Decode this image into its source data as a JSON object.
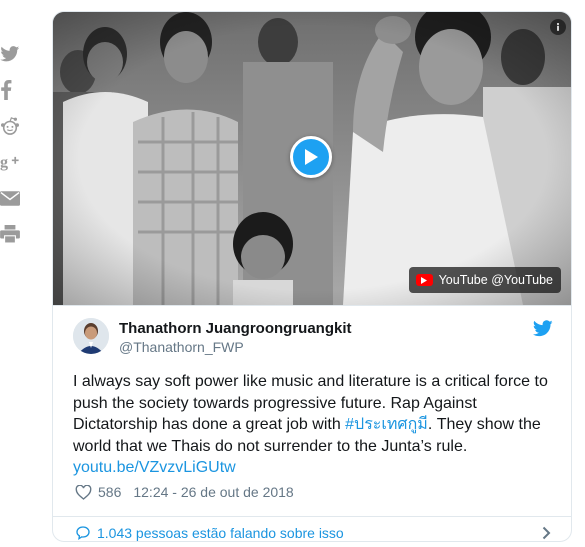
{
  "share": {
    "buttons": [
      {
        "name": "twitter-share-icon"
      },
      {
        "name": "facebook-share-icon"
      },
      {
        "name": "reddit-share-icon"
      },
      {
        "name": "google-plus-share-icon"
      },
      {
        "name": "email-share-icon"
      },
      {
        "name": "print-icon"
      }
    ]
  },
  "media": {
    "badge_label": "YouTube @YouTube"
  },
  "tweet": {
    "author_name": "Thanathorn Juangroongruangkit",
    "author_handle": "@Thanathorn_FWP",
    "text_part1": "I always say soft power like music and literature is a critical force to push the society towards progressive future. Rap Against Dictatorship has done a great job with ",
    "hashtag": "#ประเทศกูมี",
    "text_part2": ". They show the world that we Thais do not surrender to the Junta’s rule.",
    "link": "youtu.be/VZvzvLiGUtw",
    "like_count": "586",
    "timestamp": "12:24 - 26 de out de 2018",
    "footer_label": "1.043 pessoas estão falando sobre isso"
  },
  "colors": {
    "accent": "#1da1f2",
    "link": "#1b95e0",
    "secondary_text": "#657786",
    "youtube_red": "#ff0000",
    "border": "#e1e8ed",
    "share_icon": "#9b9b9b"
  }
}
